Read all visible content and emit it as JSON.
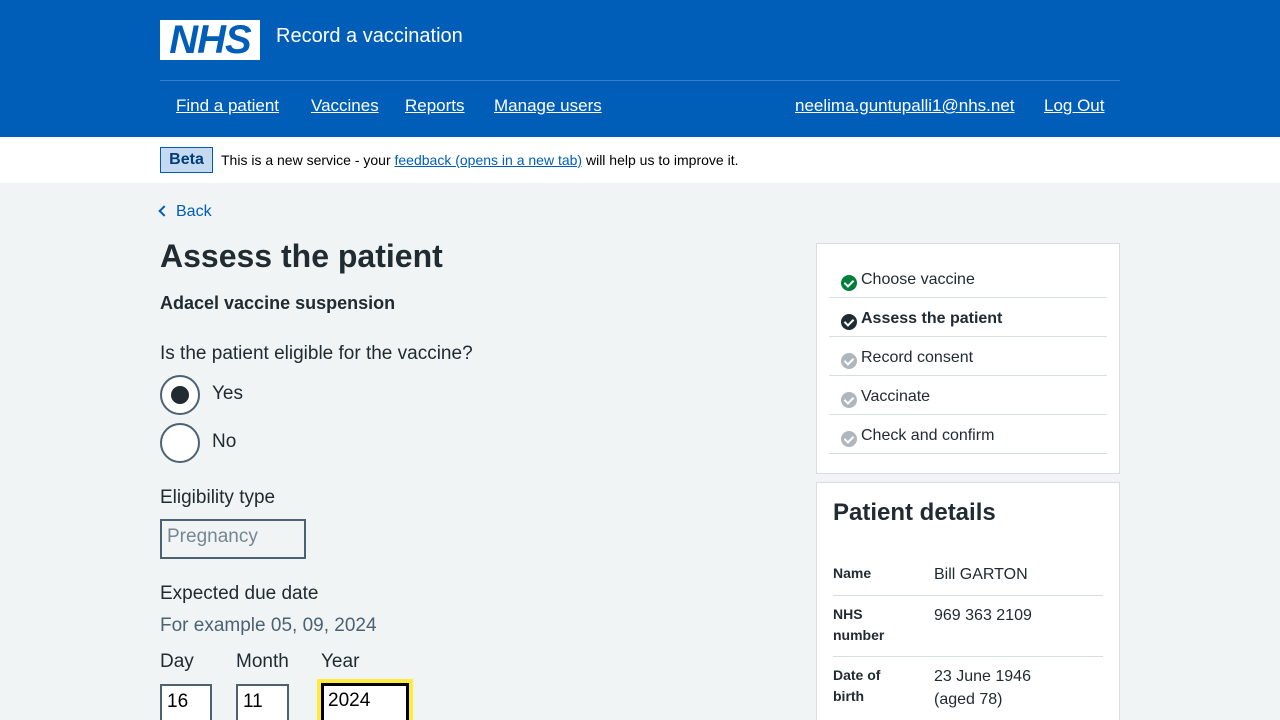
{
  "header": {
    "logo_text": "NHS",
    "service_name": "Record a vaccination",
    "nav": {
      "find_patient": "Find a patient",
      "vaccines": "Vaccines",
      "reports": "Reports",
      "manage_users": "Manage users",
      "user_email": "neelima.guntupalli1@nhs.net",
      "log_out": "Log Out"
    }
  },
  "banner": {
    "tag": "Beta",
    "text_before": "This is a new service - your ",
    "link": "feedback (opens in a new tab)",
    "text_after": " will help us to improve it."
  },
  "back_link": "Back",
  "page": {
    "title": "Assess the patient",
    "vaccine_name": "Adacel vaccine suspension",
    "question": "Is the patient eligible for the vaccine?",
    "options": [
      {
        "label": "Yes",
        "checked": true
      },
      {
        "label": "No",
        "checked": false
      }
    ],
    "eligibility_label": "Eligibility type",
    "eligibility_value": "Pregnancy",
    "due_date_label": "Expected due date",
    "due_date_hint": "For example 05, 09, 2024",
    "date": {
      "day_label": "Day",
      "month_label": "Month",
      "year_label": "Year",
      "day_value": "16",
      "month_value": "11",
      "year_value": "2024"
    }
  },
  "tasks": [
    {
      "label": "Choose vaccine",
      "status": "complete",
      "color": "#007f3b"
    },
    {
      "label": "Assess the patient",
      "status": "current",
      "color": "#212b32"
    },
    {
      "label": "Record consent",
      "status": "pending",
      "color": "#aeb7bd"
    },
    {
      "label": "Vaccinate",
      "status": "pending",
      "color": "#aeb7bd"
    },
    {
      "label": "Check and confirm",
      "status": "pending",
      "color": "#aeb7bd"
    }
  ],
  "patient": {
    "title": "Patient details",
    "rows": [
      {
        "key": "Name",
        "value": "Bill GARTON"
      },
      {
        "key": "NHS number",
        "value": "969 363 2109"
      },
      {
        "key": "Date of birth",
        "value": "23 June 1946 (aged 78)"
      }
    ]
  },
  "colors": {
    "brand": "#005eb8",
    "complete": "#007f3b",
    "focus": "#ffeb3b"
  }
}
